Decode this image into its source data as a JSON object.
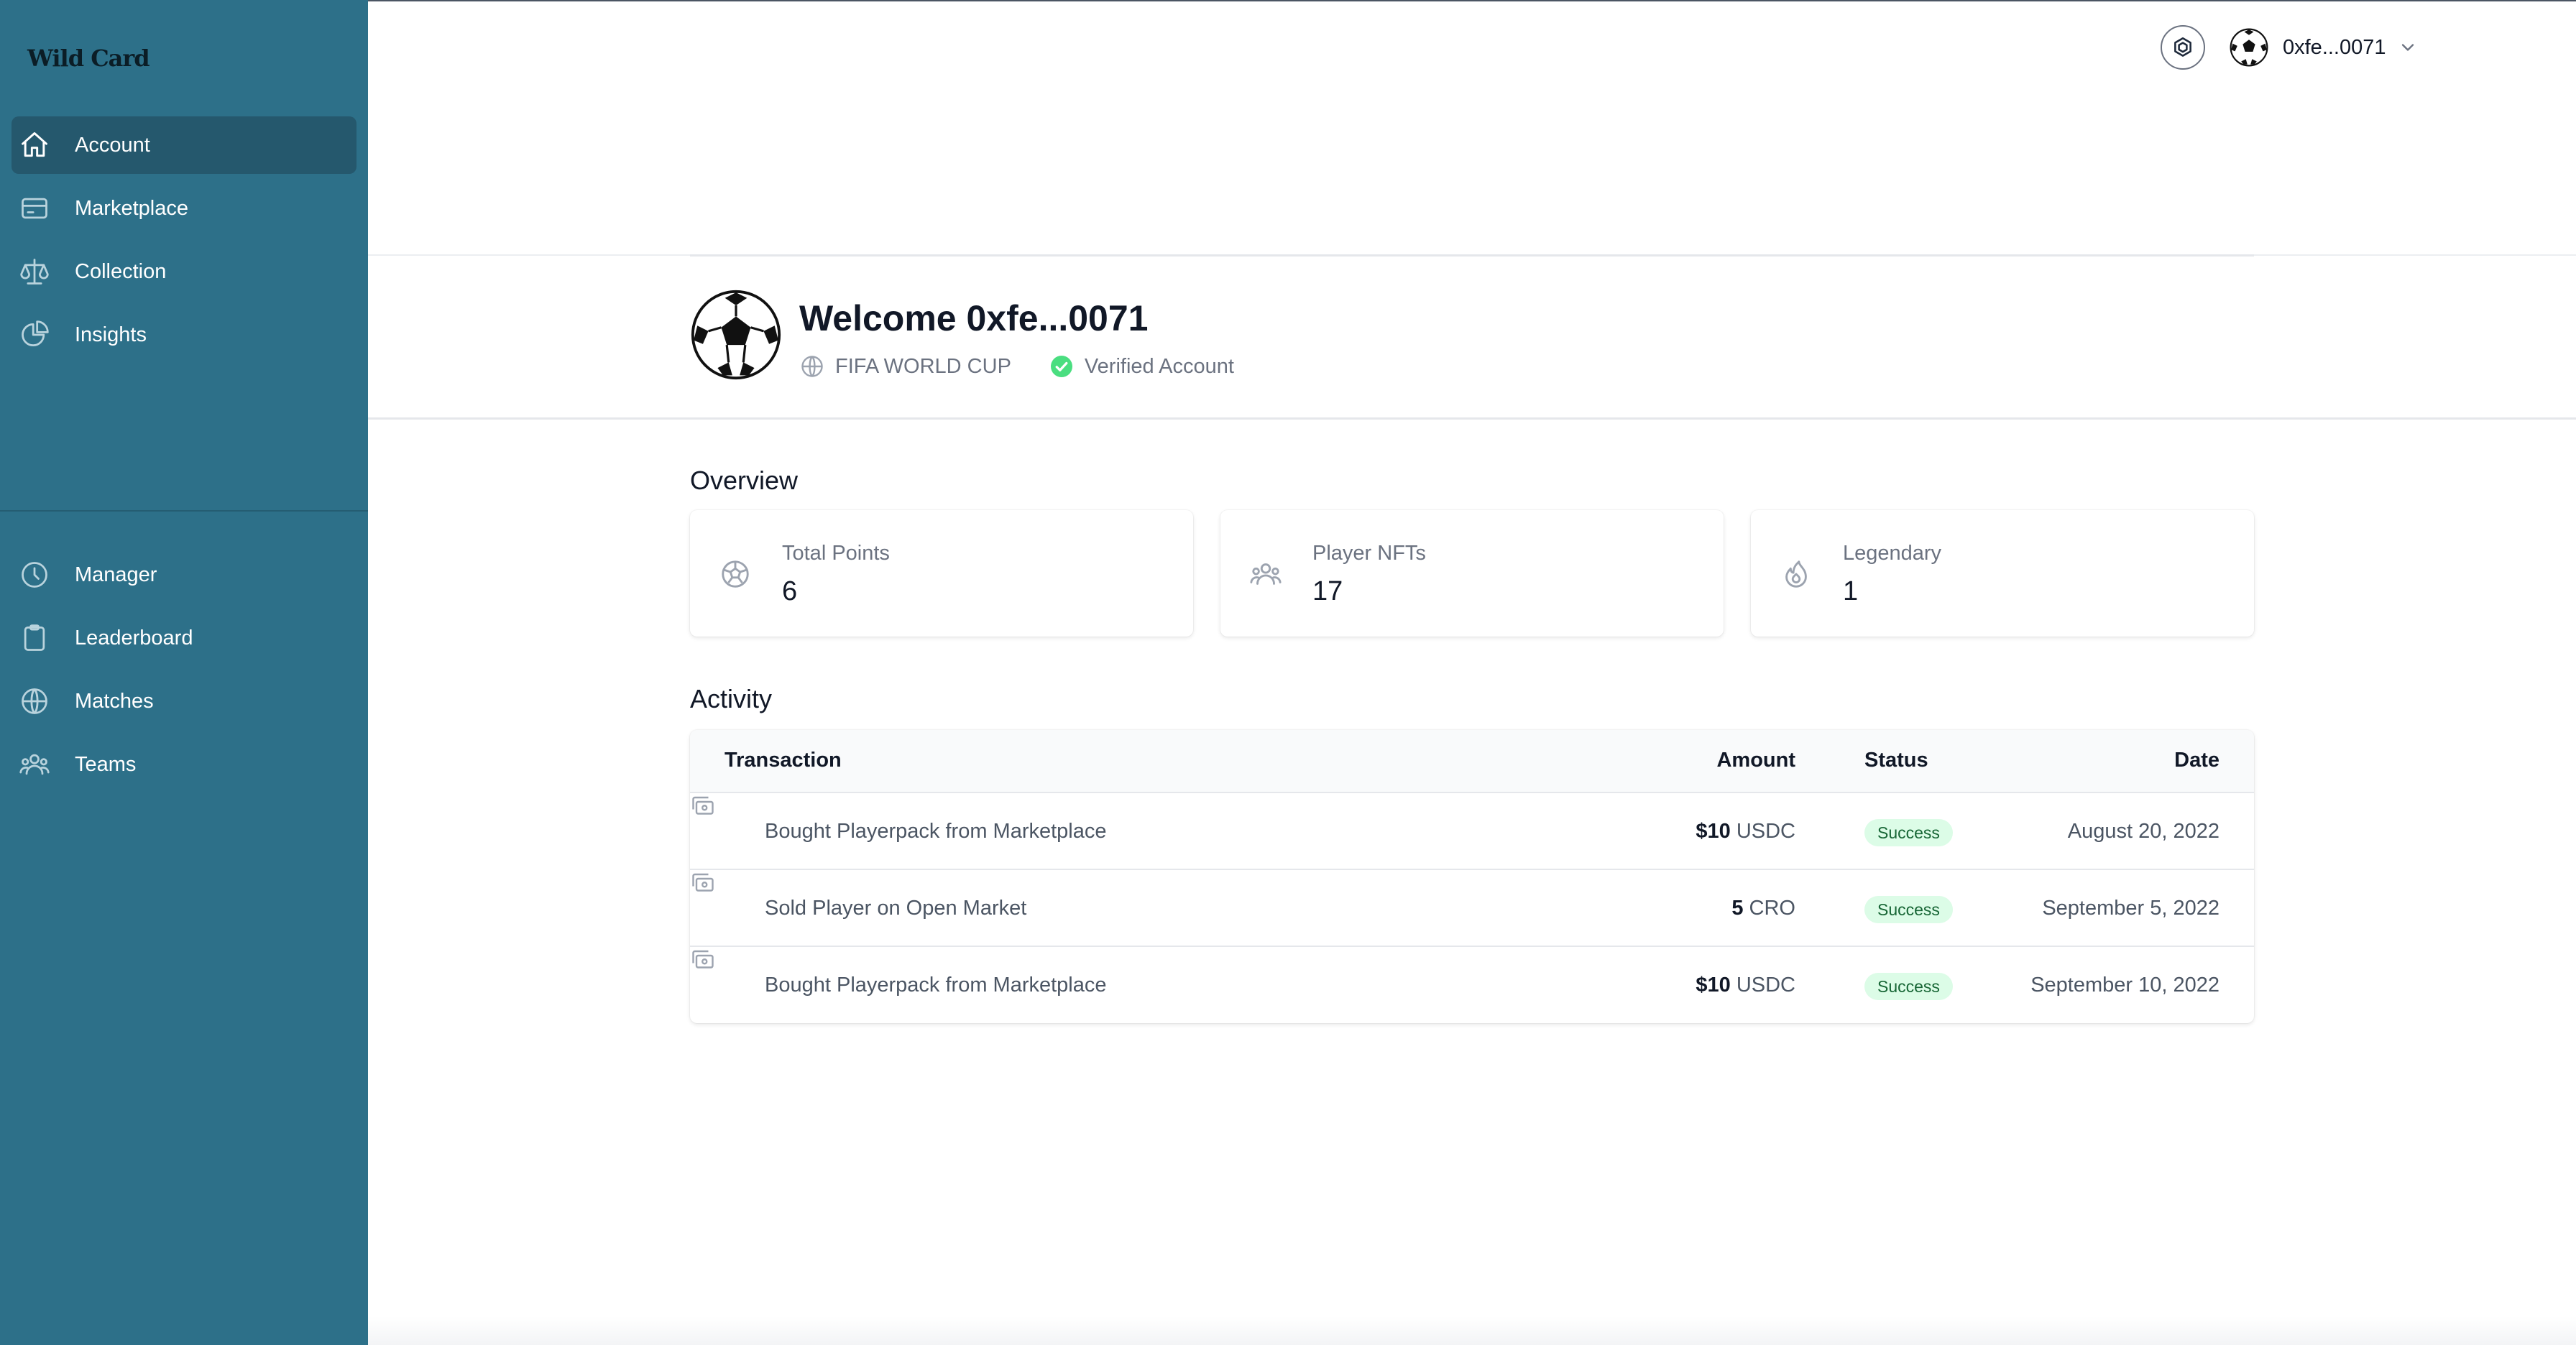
{
  "app": {
    "logo_text": "Wild Card"
  },
  "sidebar": {
    "primary": [
      {
        "label": "Account",
        "icon": "home-icon",
        "active": true
      },
      {
        "label": "Marketplace",
        "icon": "credit-card-icon"
      },
      {
        "label": "Collection",
        "icon": "scale-icon"
      },
      {
        "label": "Insights",
        "icon": "pie-chart-icon"
      }
    ],
    "secondary": [
      {
        "label": "Manager",
        "icon": "clock-icon"
      },
      {
        "label": "Leaderboard",
        "icon": "clipboard-icon"
      },
      {
        "label": "Matches",
        "icon": "globe-icon"
      },
      {
        "label": "Teams",
        "icon": "user-group-icon"
      }
    ]
  },
  "topbar": {
    "chain_icon": "cronos-chain-icon",
    "account_label": "0xfe...0071",
    "chevron_icon": "chevron-down-icon"
  },
  "profile": {
    "welcome": "Welcome 0xfe...0071",
    "league": "FIFA WORLD CUP",
    "verified": "Verified Account",
    "verified_color": "#4ade80"
  },
  "overview": {
    "title": "Overview",
    "stats": [
      {
        "label": "Total Points",
        "value": "6",
        "icon": "soccer-ball-icon"
      },
      {
        "label": "Player NFTs",
        "value": "17",
        "icon": "user-group-icon"
      },
      {
        "label": "Legendary",
        "value": "1",
        "icon": "fire-icon"
      }
    ]
  },
  "activity": {
    "title": "Activity",
    "columns": {
      "transaction": "Transaction",
      "amount": "Amount",
      "status": "Status",
      "date": "Date"
    },
    "rows": [
      {
        "name": "Bought Playerpack from Marketplace",
        "amount": "$10",
        "currency": "USDC",
        "status": "Success",
        "date": "August 20, 2022"
      },
      {
        "name": "Sold Player on Open Market",
        "amount": "5",
        "currency": "CRO",
        "status": "Success",
        "date": "September 5, 2022"
      },
      {
        "name": "Bought Playerpack from Marketplace",
        "amount": "$10",
        "currency": "USDC",
        "status": "Success",
        "date": "September 10, 2022"
      }
    ],
    "status_color": "#dcfce7"
  }
}
